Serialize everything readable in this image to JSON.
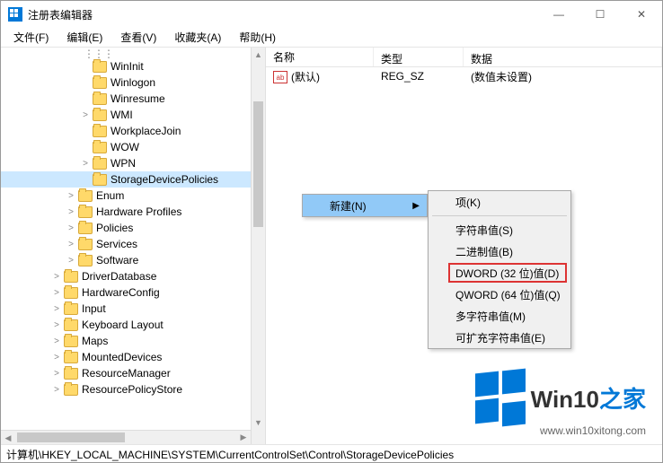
{
  "window": {
    "title": "注册表编辑器",
    "controls": {
      "min": "—",
      "max": "☐",
      "close": "✕"
    }
  },
  "menu": {
    "file": "文件(F)",
    "edit": "编辑(E)",
    "view": "查看(V)",
    "favorites": "收藏夹(A)",
    "help": "帮助(H)"
  },
  "tree": {
    "items": [
      {
        "indent": 5,
        "exp": "",
        "label": "WinInit"
      },
      {
        "indent": 5,
        "exp": "",
        "label": "Winlogon"
      },
      {
        "indent": 5,
        "exp": "",
        "label": "Winresume"
      },
      {
        "indent": 5,
        "exp": ">",
        "label": "WMI"
      },
      {
        "indent": 5,
        "exp": "",
        "label": "WorkplaceJoin"
      },
      {
        "indent": 5,
        "exp": "",
        "label": "WOW"
      },
      {
        "indent": 5,
        "exp": ">",
        "label": "WPN"
      },
      {
        "indent": 5,
        "exp": "",
        "label": "StorageDevicePolicies",
        "sel": true
      },
      {
        "indent": 4,
        "exp": ">",
        "label": "Enum"
      },
      {
        "indent": 4,
        "exp": ">",
        "label": "Hardware Profiles"
      },
      {
        "indent": 4,
        "exp": ">",
        "label": "Policies"
      },
      {
        "indent": 4,
        "exp": ">",
        "label": "Services"
      },
      {
        "indent": 4,
        "exp": ">",
        "label": "Software"
      },
      {
        "indent": 3,
        "exp": ">",
        "label": "DriverDatabase"
      },
      {
        "indent": 3,
        "exp": ">",
        "label": "HardwareConfig"
      },
      {
        "indent": 3,
        "exp": ">",
        "label": "Input"
      },
      {
        "indent": 3,
        "exp": ">",
        "label": "Keyboard Layout"
      },
      {
        "indent": 3,
        "exp": ">",
        "label": "Maps"
      },
      {
        "indent": 3,
        "exp": ">",
        "label": "MountedDevices"
      },
      {
        "indent": 3,
        "exp": ">",
        "label": "ResourceManager"
      },
      {
        "indent": 3,
        "exp": ">",
        "label": "ResourcePolicyStore"
      }
    ]
  },
  "list": {
    "headers": {
      "name": "名称",
      "type": "类型",
      "data": "数据"
    },
    "rows": [
      {
        "name": "(默认)",
        "type": "REG_SZ",
        "data": "(数值未设置)"
      }
    ]
  },
  "context": {
    "new": "新建(N)",
    "submenu": {
      "key": "项(K)",
      "string": "字符串值(S)",
      "binary": "二进制值(B)",
      "dword": "DWORD (32 位)值(D)",
      "qword": "QWORD (64 位)值(Q)",
      "multi": "多字符串值(M)",
      "expand": "可扩充字符串值(E)"
    }
  },
  "statusbar": "计算机\\HKEY_LOCAL_MACHINE\\SYSTEM\\CurrentControlSet\\Control\\StorageDevicePolicies",
  "watermark": {
    "brand_a": "Win10",
    "brand_b": "之家",
    "url": "www.win10xitong.com"
  }
}
